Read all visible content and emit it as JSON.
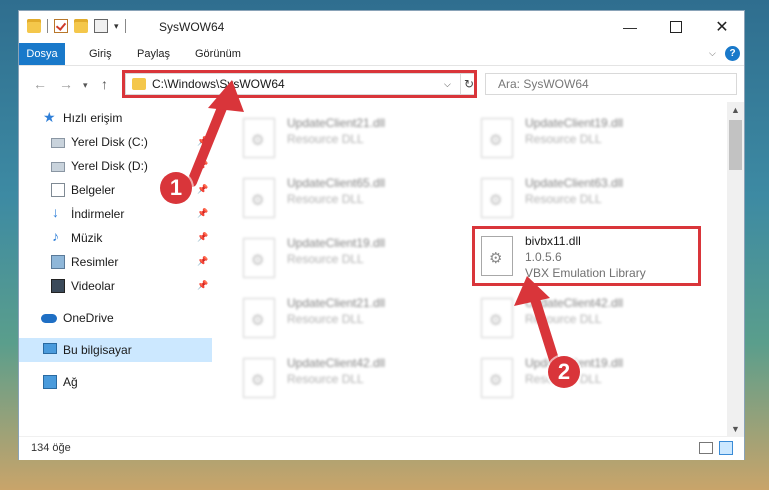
{
  "window": {
    "title": "SysWOW64",
    "controls": {
      "minimize": "—",
      "maximize": "",
      "close": "✕"
    }
  },
  "ribbon": {
    "tabs": [
      "Dosya",
      "Giriş",
      "Paylaş",
      "Görünüm"
    ],
    "help": "?"
  },
  "address": {
    "path": "C:\\Windows\\SysWOW64",
    "refresh": "↻",
    "search_placeholder": "Ara: SysWOW64"
  },
  "nav": {
    "items": [
      {
        "label": "Hızlı erişim",
        "icon": "star-icon"
      },
      {
        "label": "Yerel Disk (C:)",
        "icon": "disk-icon",
        "pinned": true
      },
      {
        "label": "Yerel Disk (D:)",
        "icon": "disk-icon",
        "pinned": true
      },
      {
        "label": "Belgeler",
        "icon": "documents-icon",
        "pinned": true
      },
      {
        "label": "İndirmeler",
        "icon": "downloads-icon",
        "pinned": true
      },
      {
        "label": "Müzik",
        "icon": "music-icon",
        "pinned": true
      },
      {
        "label": "Resimler",
        "icon": "pictures-icon",
        "pinned": true
      },
      {
        "label": "Videolar",
        "icon": "videos-icon",
        "pinned": true
      },
      {
        "label": "OneDrive",
        "icon": "onedrive-icon"
      },
      {
        "label": "Bu bilgisayar",
        "icon": "this-pc-icon",
        "selected": true
      },
      {
        "label": "Ağ",
        "icon": "network-icon"
      }
    ]
  },
  "files": [
    {
      "name": "UpdateClient21.dll",
      "type": "Resource DLL"
    },
    {
      "name": "UpdateClient19.dll",
      "type": "Resource DLL"
    },
    {
      "name": "UpdateClient65.dll",
      "type": "Resource DLL"
    },
    {
      "name": "UpdateClient63.dll",
      "type": "Resource DLL"
    },
    {
      "name": "UpdateClient19.dll",
      "type": "Resource DLL"
    },
    {
      "name": "bivbx11.dll",
      "version": "1.0.5.6",
      "type": "VBX Emulation Library"
    },
    {
      "name": "UpdateClient21.dll",
      "type": "Resource DLL"
    },
    {
      "name": "UpdateClient42.dll",
      "type": "Resource DLL"
    },
    {
      "name": "UpdateClient42.dll",
      "type": "Resource DLL"
    },
    {
      "name": "UpdateClient19.dll",
      "type": "Resource DLL"
    }
  ],
  "status": {
    "item_count": "134 öğe"
  },
  "callouts": {
    "one": "1",
    "two": "2"
  },
  "colors": {
    "accent": "#1979ca",
    "highlight": "#d9353a",
    "selected": "#cce8ff"
  }
}
